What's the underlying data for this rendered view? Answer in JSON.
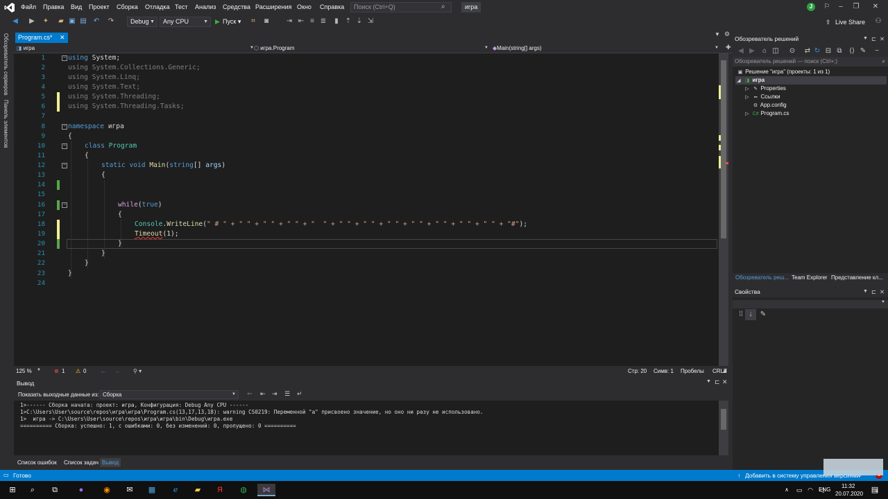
{
  "menubar": {
    "items": [
      "Файл",
      "Правка",
      "Вид",
      "Проект",
      "Сборка",
      "Отладка",
      "Тест",
      "Анализ",
      "Средства",
      "Расширения",
      "Окно",
      "Справка"
    ],
    "search_placeholder": "Поиск (Ctrl+Q)",
    "project_title": "игра",
    "user_initial": "J"
  },
  "toolbar": {
    "config": "Debug",
    "platform": "Any CPU",
    "start_label": "Пуск",
    "live_share": "Live Share"
  },
  "left_strip": {
    "server_explorer": "Обозреватель серверов",
    "toolbox": "Панель элементов"
  },
  "editor": {
    "tab_label": "Program.cs*",
    "nav_project": "игра",
    "nav_class": "игра.Program",
    "nav_member": "Main(string[] args)",
    "line_numbers": [
      "1",
      "2",
      "3",
      "4",
      "5",
      "6",
      "7",
      "8",
      "9",
      "10",
      "11",
      "12",
      "13",
      "14",
      "15",
      "16",
      "17",
      "18",
      "19",
      "20",
      "21",
      "22",
      "23",
      "24"
    ],
    "lines": {
      "l1_kw": "using",
      "l1_rest": " System;",
      "l2_kw": "using",
      "l2_rest": " System.Collections.Generic;",
      "l3_kw": "using",
      "l3_rest": " System.Linq;",
      "l4_kw": "using",
      "l4_rest": " System.Text;",
      "l5_kw": "using",
      "l5_rest": " System.Threading;",
      "l6_kw": "using",
      "l6_rest": " System.Threading.Tasks;",
      "l8_kw": "namespace",
      "l8_rest": " игра",
      "l9": "{",
      "l10_kw": "class",
      "l10_type": "Program",
      "l11": "{",
      "l12_kw1": "static",
      "l12_kw2": "void",
      "l12_method": "Main",
      "l12_open": "(",
      "l12_kw3": "string",
      "l12_br": "[] ",
      "l12_param": "args",
      "l12_close": ")",
      "l13": "{",
      "l16_kw": "while",
      "l16_open": "(",
      "l16_val": "true",
      "l16_close": ")",
      "l17": "{",
      "l18_type": "Console",
      "l18_dot": ".",
      "l18_method": "WriteLine",
      "l18_open": "(",
      "l18_args": "\" # \" + \" \" + \" \" + \" \" + \"  \" + \" \" + \" \" + \" \" + \" \" + \" \" + \" \" + \" \" + \"#\"",
      "l18_close": ");",
      "l19_method": "Timeout",
      "l19_rest": "(1);",
      "l20": "}",
      "l21": "}",
      "l22": "}",
      "l23": "}"
    },
    "zoom": "125 %",
    "errors": "1",
    "warnings": "0",
    "line": "Стр: 20",
    "col": "Симв: 1",
    "spaces": "Пробелы",
    "eol": "CRLF"
  },
  "output": {
    "title": "Вывод",
    "show_from_label": "Показать выходные данные из:",
    "source": "Сборка",
    "lines": [
      "1>------ Сборка начата: проект: игра, Конфигурация: Debug Any CPU ------",
      "1>C:\\Users\\User\\source\\repos\\игра\\игра\\Program.cs(13,17,13,18): warning CS0219: Переменной \"a\" присвоено значение, но оно ни разу не использовано.",
      "1>  игра -> C:\\Users\\User\\source\\repos\\игра\\игра\\bin\\Debug\\игра.exe",
      "========== Сборка: успешно: 1, с ошибками: 0, без изменений: 0, пропущено: 0 =========="
    ]
  },
  "bottom_tabs": [
    "Список ошибок",
    "Список задач",
    "Вывод"
  ],
  "solution": {
    "title": "Обозреватель решений",
    "search_placeholder": "Обозреватель решений — поиск (Ctrl+;)",
    "solution_node": "Решение \"игра\" (проекты: 1 из 1)",
    "project_node": "игра",
    "properties": "Properties",
    "references": "Ссылки",
    "app_config": "App.config",
    "program_cs": "Program.cs",
    "tabs": [
      "Обозреватель реш...",
      "Team Explorer",
      "Представление кл..."
    ]
  },
  "properties_panel": {
    "title": "Свойства"
  },
  "statusbar": {
    "ready": "Готово",
    "source_control": "Добавить в систему управления версиями",
    "badge": "1"
  },
  "taskbar": {
    "lang": "ENG",
    "time": "11:32",
    "date": "20.07.2020",
    "notify_count": "4"
  },
  "colors": {
    "accent": "#007acc",
    "editor_bg": "#1e1e1e",
    "keyword": "#569cd6",
    "type": "#4ec9b0",
    "string": "#d69d85"
  }
}
